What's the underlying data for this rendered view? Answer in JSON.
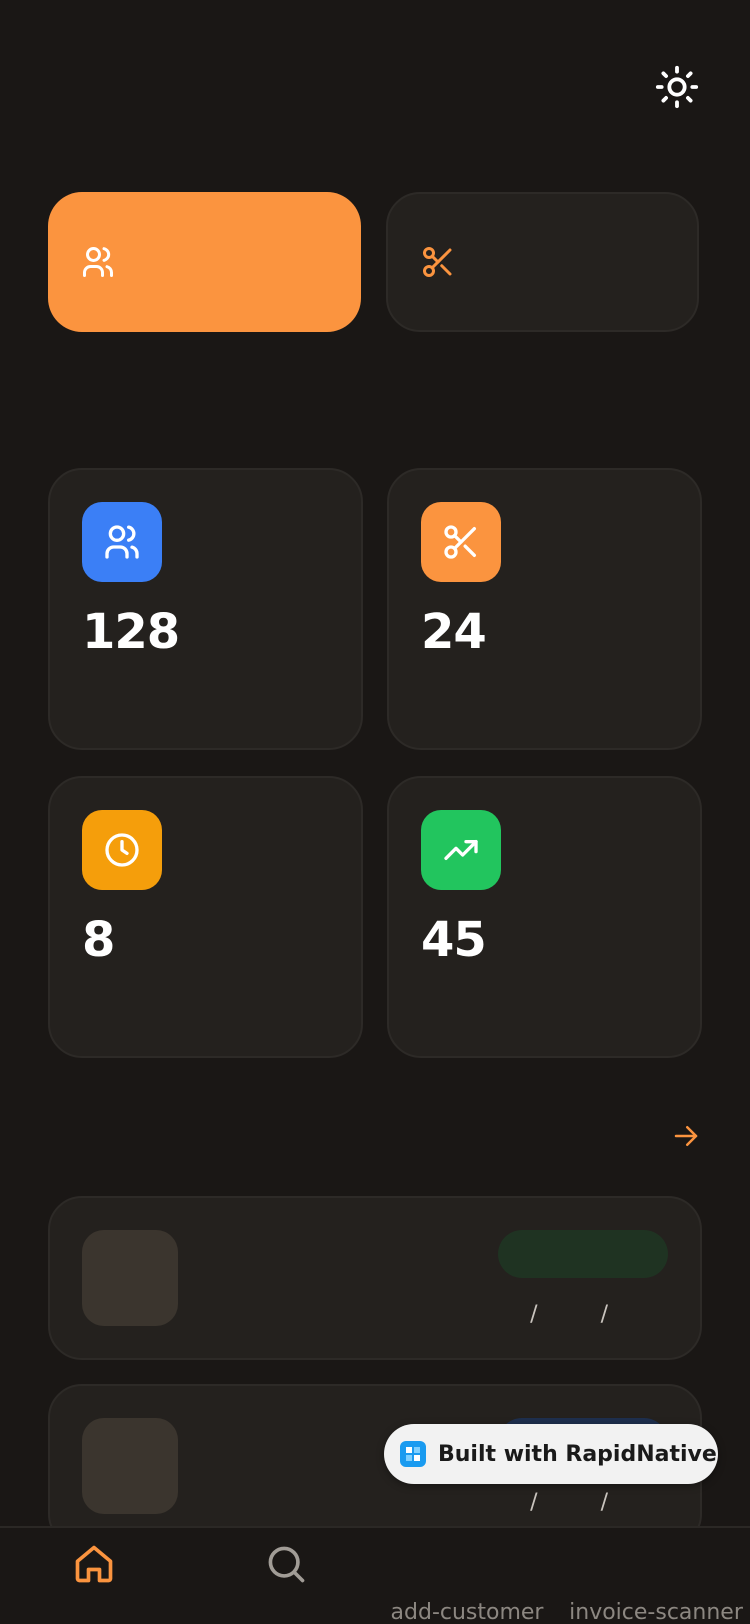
{
  "header": {
    "theme_icon": "sun-icon"
  },
  "actions": {
    "primary": {
      "icon": "users-icon",
      "label": "",
      "color": "#fb943f"
    },
    "secondary": {
      "icon": "scissors-icon",
      "label": "",
      "color": "#24211e",
      "icon_color": "#fb943f"
    }
  },
  "stats": [
    {
      "icon": "users-icon",
      "color": "#3b7ff6",
      "value": "128",
      "label": ""
    },
    {
      "icon": "scissors-icon",
      "color": "#fb943f",
      "value": "24",
      "label": ""
    },
    {
      "icon": "clock-icon",
      "color": "#f59e0b",
      "value": "8",
      "label": ""
    },
    {
      "icon": "trending-up-icon",
      "color": "#22c55e",
      "value": "45",
      "label": ""
    }
  ],
  "recent": {
    "see_all_icon": "arrow-right-icon",
    "items": [
      {
        "date_text": "/ /",
        "pill_color": "#1f3322"
      },
      {
        "date_text": "/ /",
        "pill_color": "#1e2f4e"
      }
    ]
  },
  "bottom_nav": {
    "home_icon": "home-icon",
    "search_icon": "search-icon",
    "add_customer": "add-customer",
    "invoice_scanner": "invoice-scanner"
  },
  "badge": {
    "text": "Built with RapidNative"
  },
  "colors": {
    "accent": "#fb943f",
    "background": "#1a1715",
    "card": "#24211e"
  }
}
